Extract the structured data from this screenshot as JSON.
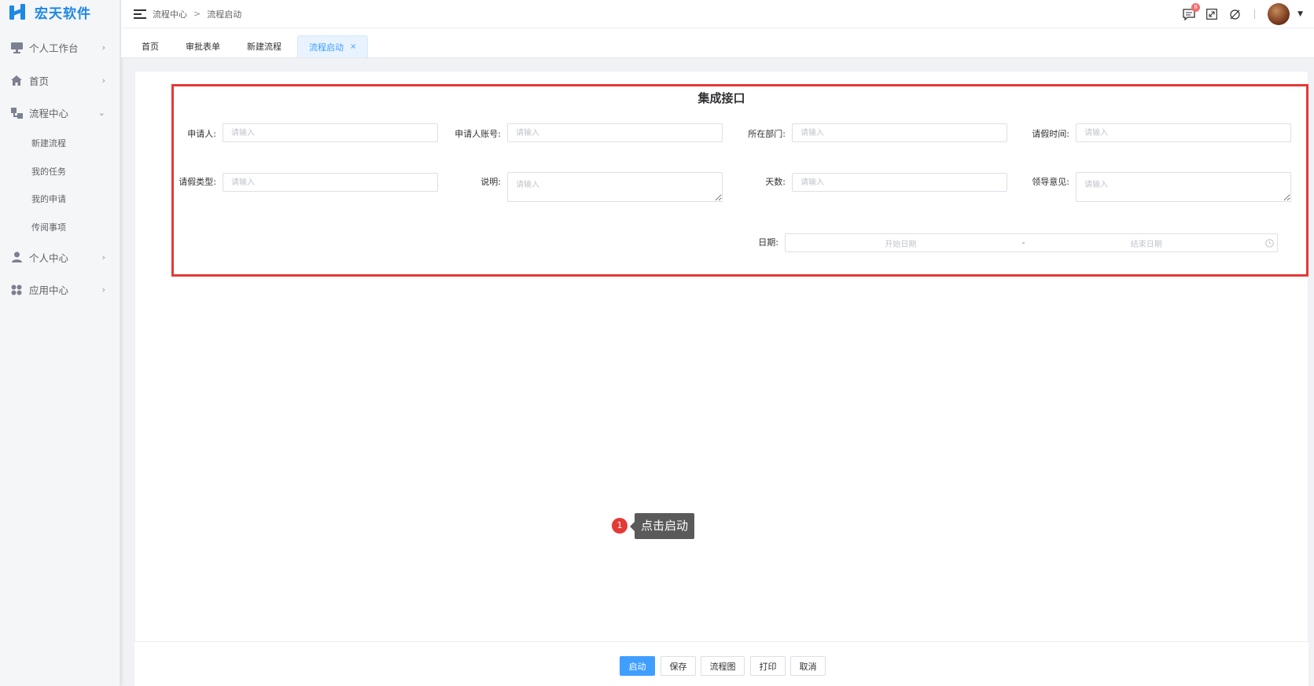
{
  "app": {
    "logo_text": "宏天软件"
  },
  "sidebar": {
    "items": [
      {
        "label": "个人工作台",
        "icon": "monitor-icon"
      },
      {
        "label": "首页",
        "icon": "home-icon"
      },
      {
        "label": "流程中心",
        "icon": "flow-icon",
        "expanded": true,
        "children": [
          {
            "label": "新建流程"
          },
          {
            "label": "我的任务"
          },
          {
            "label": "我的申请"
          },
          {
            "label": "传阅事项"
          }
        ]
      },
      {
        "label": "个人中心",
        "icon": "user-icon"
      },
      {
        "label": "应用中心",
        "icon": "apps-icon"
      }
    ]
  },
  "header": {
    "breadcrumb": [
      "流程中心",
      "流程启动"
    ],
    "separator": ">",
    "notification_count": "8"
  },
  "tabs": [
    {
      "label": "首页"
    },
    {
      "label": "审批表单"
    },
    {
      "label": "新建流程"
    },
    {
      "label": "流程启动",
      "active": true,
      "close": "×"
    }
  ],
  "form": {
    "title": "集成接口",
    "placeholder": "请输入",
    "fields": {
      "applicant": "申请人:",
      "applicant_account": "申请人账号:",
      "department": "所在部门:",
      "leave_time": "请假时间:",
      "leave_type": "请假类型:",
      "description": "说明:",
      "days": "天数:",
      "leader_opinion": "领导意见:",
      "date": "日期:"
    },
    "date_range": {
      "start": "开始日期",
      "separator": "-",
      "end": "结束日期"
    }
  },
  "annotation": {
    "step": "1",
    "text": "点击启动"
  },
  "actions": {
    "start": "启动",
    "save": "保存",
    "flowchart": "流程图",
    "print": "打印",
    "cancel": "取消"
  },
  "colors": {
    "primary": "#409eff",
    "brand": "#1e88e5",
    "highlight": "#e53935",
    "badge": "#f56c6c"
  }
}
